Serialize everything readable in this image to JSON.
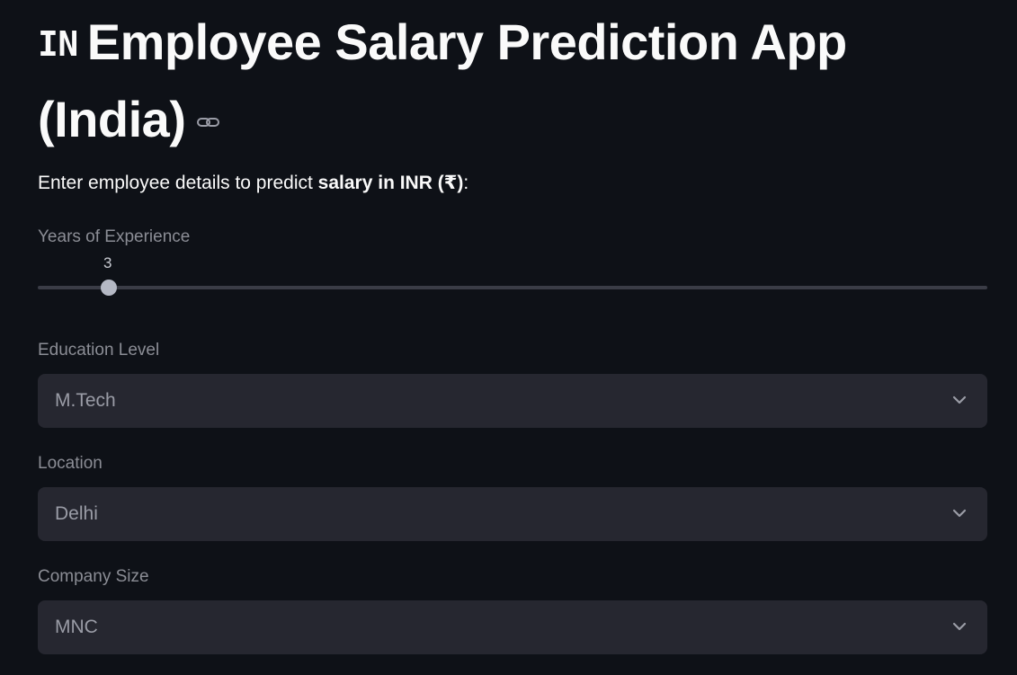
{
  "header": {
    "flag_text": "IN",
    "title": "Employee Salary Prediction App (India)"
  },
  "intro": {
    "prefix": "Enter employee details to predict ",
    "bold": "salary in INR (₹)",
    "suffix": ":"
  },
  "experience": {
    "label": "Years of Experience",
    "value": "3",
    "fraction": 0.075
  },
  "education": {
    "label": "Education Level",
    "selected": "M.Tech"
  },
  "location": {
    "label": "Location",
    "selected": "Delhi"
  },
  "company_size": {
    "label": "Company Size",
    "selected": "MNC"
  },
  "icons": {
    "anchor": "link-icon",
    "dropdown": "chevron-down-icon"
  },
  "colors": {
    "background": "#0e1117",
    "input_bg": "#262730",
    "slider_thumb": "#b4b8c4"
  }
}
